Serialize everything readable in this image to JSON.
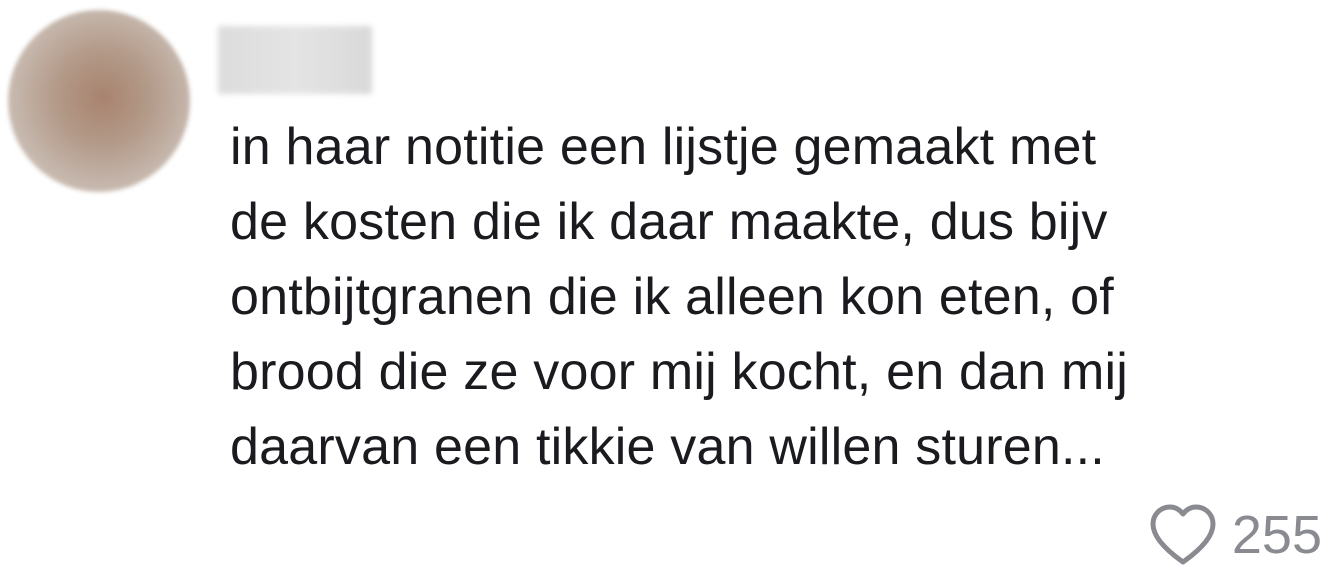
{
  "comment": {
    "author_avatar": "blurred-avatar",
    "author_name": "",
    "text_lines": [
      "in haar notitie een lijstje gemaakt met",
      "de kosten die ik daar maakte, dus bijv",
      "ontbijtgranen die ik alleen kon eten, of",
      "brood die ze voor mij kocht, en dan mij",
      "daarvan een tikkie van willen sturen..."
    ],
    "likes": {
      "icon": "heart-icon",
      "count": "255"
    }
  },
  "colors": {
    "background": "#ffffff",
    "text": "#1a1a1f",
    "meta": "#8a8b91",
    "heart_stroke": "#8a8b91"
  }
}
